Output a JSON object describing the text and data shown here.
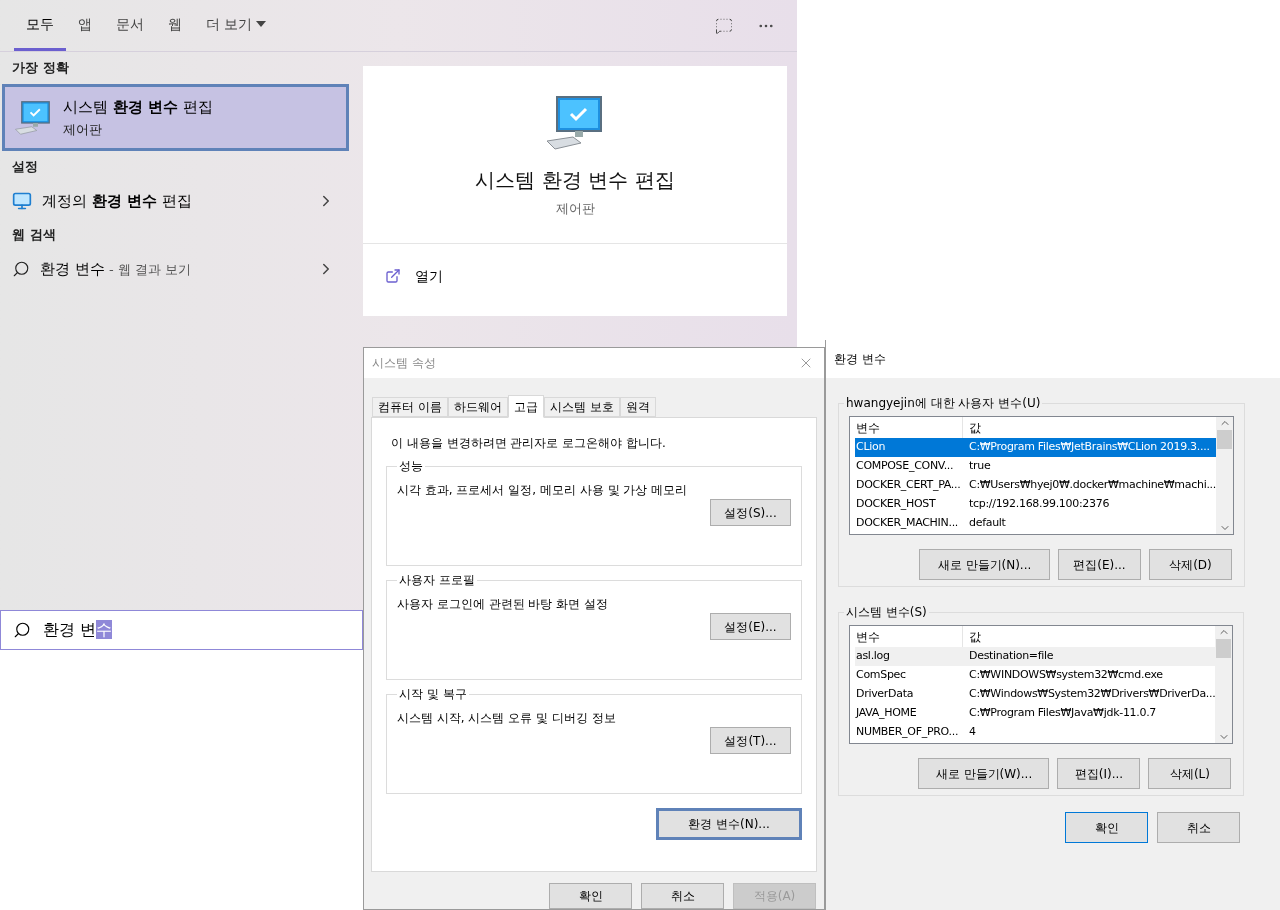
{
  "search_panel": {
    "tabs": [
      {
        "label": "모두",
        "selected": true,
        "kind": "tab"
      },
      {
        "label": "앱",
        "selected": false,
        "kind": "tab"
      },
      {
        "label": "문서",
        "selected": false,
        "kind": "tab"
      },
      {
        "label": "웹",
        "selected": false,
        "kind": "tab"
      },
      {
        "label": "더 보기",
        "selected": false,
        "kind": "dropdown"
      }
    ],
    "sections": [
      {
        "heading": "가장 정확",
        "items": [
          {
            "kind": "best",
            "title": "시스템 **환경 변수** 편집",
            "subtitle": "제어판",
            "selected": true
          }
        ]
      },
      {
        "heading": "설정",
        "items": [
          {
            "kind": "setting",
            "title": "계정의 **환경 변수** 편집",
            "selected": false
          }
        ]
      },
      {
        "heading": "웹 검색",
        "items": [
          {
            "kind": "web",
            "title": "환경 변수",
            "suffix": " - 웹 결과 보기",
            "selected": false
          }
        ]
      }
    ],
    "preview": {
      "title": "시스템 환경 변수 편집",
      "subtitle": "제어판",
      "actions": [
        "열기"
      ]
    },
    "search": {
      "text": "환경 변",
      "composing": "수"
    }
  },
  "system_properties": {
    "title": "시스템 속성",
    "tabs": [
      {
        "label": "컴퓨터 이름",
        "selected": false
      },
      {
        "label": "하드웨어",
        "selected": false
      },
      {
        "label": "고급",
        "selected": true
      },
      {
        "label": "시스템 보호",
        "selected": false
      },
      {
        "label": "원격",
        "selected": false
      }
    ],
    "notice": "이 내용을 변경하려면 관리자로 로그온해야 합니다.",
    "groups": [
      {
        "title": "성능",
        "description": "시각 효과, 프로세서 일정, 메모리 사용 및 가상 메모리",
        "button": "설정(S)..."
      },
      {
        "title": "사용자 프로필",
        "description": "사용자 로그인에 관련된 바탕 화면 설정",
        "button": "설정(E)..."
      },
      {
        "title": "시작 및 복구",
        "description": "시스템 시작, 시스템 오류 및 디버깅 정보",
        "button": "설정(T)..."
      }
    ],
    "env_button": {
      "label": "환경 변수(N)...",
      "focused": true
    },
    "buttons": [
      {
        "label": "확인",
        "disabled": false
      },
      {
        "label": "취소",
        "disabled": false
      },
      {
        "label": "적용(A)",
        "disabled": true
      }
    ]
  },
  "environment_variables": {
    "title": "환경 변수",
    "groups": [
      {
        "title": "hwangyejin에 대한 사용자 변수(U)",
        "columns": [
          "변수",
          "값"
        ],
        "rows": [
          {
            "name": "CLion",
            "value": "C:₩Program Files₩JetBrains₩CLion 2019.3....",
            "selected": true,
            "hover": false
          },
          {
            "name": "COMPOSE_CONV...",
            "value": "true",
            "selected": false,
            "hover": false
          },
          {
            "name": "DOCKER_CERT_PA...",
            "value": "C:₩Users₩hyej0₩.docker₩machine₩machi...",
            "selected": false,
            "hover": false
          },
          {
            "name": "DOCKER_HOST",
            "value": "tcp://192.168.99.100:2376",
            "selected": false,
            "hover": false
          },
          {
            "name": "DOCKER_MACHIN...",
            "value": "default",
            "selected": false,
            "hover": false
          }
        ],
        "buttons": [
          "새로 만들기(N)...",
          "편집(E)...",
          "삭제(D)"
        ]
      },
      {
        "title": "시스템 변수(S)",
        "columns": [
          "변수",
          "값"
        ],
        "rows": [
          {
            "name": "asl.log",
            "value": "Destination=file",
            "selected": false,
            "hover": true
          },
          {
            "name": "ComSpec",
            "value": "C:₩WINDOWS₩system32₩cmd.exe",
            "selected": false,
            "hover": false
          },
          {
            "name": "DriverData",
            "value": "C:₩Windows₩System32₩Drivers₩DriverDa...",
            "selected": false,
            "hover": false
          },
          {
            "name": "JAVA_HOME",
            "value": "C:₩Program Files₩Java₩jdk-11.0.7",
            "selected": false,
            "hover": false
          },
          {
            "name": "NUMBER_OF_PRO...",
            "value": "4",
            "selected": false,
            "hover": false
          }
        ],
        "buttons": [
          "새로 만들기(W)...",
          "편집(I)...",
          "삭제(L)"
        ]
      }
    ],
    "buttons": [
      {
        "label": "확인",
        "focused": true
      },
      {
        "label": "취소",
        "focused": false
      }
    ]
  }
}
